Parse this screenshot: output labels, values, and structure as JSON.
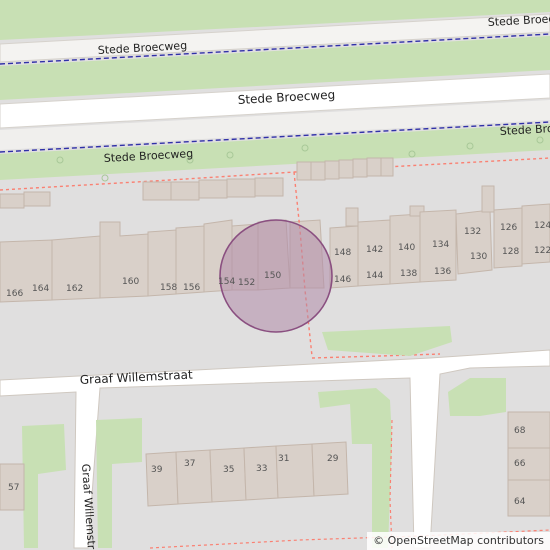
{
  "map": {
    "streets": [
      {
        "name": "Stede Broecweg"
      },
      {
        "name": "Stede Broecweg"
      },
      {
        "name": "Stede Broecweg"
      },
      {
        "name": "Stede Broecweg"
      },
      {
        "name": "Stede Broecweg"
      },
      {
        "name": "Graaf Willemstraat"
      },
      {
        "name": "Graaf Willemstr"
      }
    ],
    "house_numbers": {
      "north_row": [
        "166",
        "164",
        "162",
        "160",
        "158",
        "156",
        "154",
        "152",
        "150",
        "148",
        "146",
        "142",
        "144",
        "140",
        "138",
        "134",
        "136",
        "132",
        "130",
        "126",
        "128",
        "124",
        "122"
      ],
      "south_row": [
        "39",
        "37",
        "35",
        "33",
        "31",
        "29"
      ],
      "east_column": [
        "68",
        "66",
        "64"
      ],
      "west": [
        "57"
      ]
    },
    "marker": {
      "kind": "location-circle",
      "fill": "#b08aa8",
      "stroke": "#8a4f80"
    },
    "colors": {
      "background": "#e0dfdf",
      "building": "#d9d0c9",
      "building_stroke": "#c4b6ab",
      "park": "#c8e0b4",
      "road": "#ffffff",
      "road_casing": "#cfc8c0",
      "path": "#fa8072",
      "track": "#2020a0"
    }
  },
  "attribution": {
    "symbol": "©",
    "text": "OpenStreetMap contributors"
  }
}
